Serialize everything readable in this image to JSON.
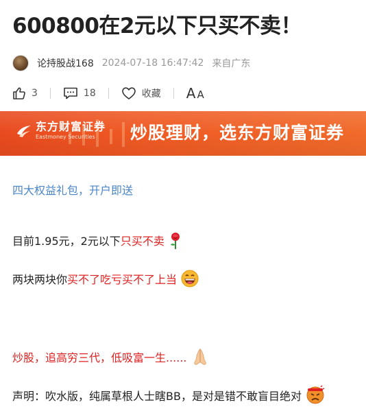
{
  "article": {
    "title": "600800在2元以下只买不卖！",
    "author": "论持股战168",
    "time": "2024-07-18 16:47:42",
    "from": "来自广东"
  },
  "actions": {
    "like_count": "3",
    "comment_count": "18",
    "favorite_label": "收藏",
    "font_big": "A",
    "font_small": "A"
  },
  "banner": {
    "brand_cn": "东方财富证券",
    "brand_en": "Eastmoney Securities",
    "slogan": "炒股理财，选东方财富证券"
  },
  "body": {
    "promo_link": "四大权益礼包，开户即送",
    "line1_prefix": "目前1.95元，2元以下",
    "line1_red": "只买不卖",
    "line2_prefix": "两块两块你",
    "line2_red": "买不了吃亏买不了上当",
    "line3_red": "炒股，追高穷三代，低吸富一生......",
    "line4": "声明：吹水版，纯属草根人士瞎BB，是对是错不敢盲目绝对"
  },
  "colors": {
    "accent_red": "#e02020",
    "link_blue": "#4a86c8",
    "banner_orange": "#ef5a24"
  },
  "icons": [
    "like-icon",
    "comment-icon",
    "heart-icon",
    "rose-emoji",
    "grin-emoji",
    "pray-emoji",
    "angry-emoji"
  ]
}
